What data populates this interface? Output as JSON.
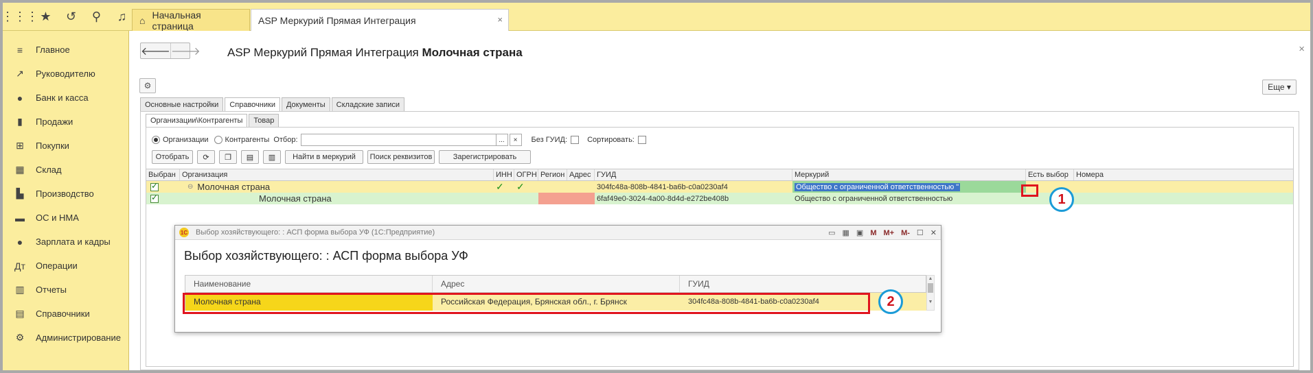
{
  "topbar": {
    "icons": [
      "grid-icon",
      "star-icon",
      "history-icon",
      "search-icon",
      "bell-icon"
    ],
    "tabs": [
      {
        "label": "Начальная страница",
        "icon": "home-icon"
      },
      {
        "label": "ASP Меркурий Прямая Интеграция",
        "close": "×"
      }
    ]
  },
  "sidebar": {
    "items": [
      {
        "label": "Главное",
        "icon": "menu-icon",
        "glyph": "≡"
      },
      {
        "label": "Руководителю",
        "icon": "trend-icon",
        "glyph": "↗"
      },
      {
        "label": "Банк и касса",
        "icon": "coin-icon",
        "glyph": "●"
      },
      {
        "label": "Продажи",
        "icon": "bag-icon",
        "glyph": "▮"
      },
      {
        "label": "Покупки",
        "icon": "cart-icon",
        "glyph": "⊞"
      },
      {
        "label": "Склад",
        "icon": "warehouse-icon",
        "glyph": "▦"
      },
      {
        "label": "Производство",
        "icon": "factory-icon",
        "glyph": "▙"
      },
      {
        "label": "ОС и НМА",
        "icon": "truck-icon",
        "glyph": "▬"
      },
      {
        "label": "Зарплата и кадры",
        "icon": "person-icon",
        "glyph": "●"
      },
      {
        "label": "Операции",
        "icon": "dt-kt-icon",
        "glyph": "Дт"
      },
      {
        "label": "Отчеты",
        "icon": "bar-chart-icon",
        "glyph": "▥"
      },
      {
        "label": "Справочники",
        "icon": "book-icon",
        "glyph": "▤"
      },
      {
        "label": "Администрирование",
        "icon": "gear-icon",
        "glyph": "⚙"
      }
    ]
  },
  "main": {
    "title": "ASP Меркурий Прямая Интеграция",
    "title_bold": "Молочная страна",
    "close": "×",
    "more_button": "Еще ▾",
    "tabs": [
      "Основные настройки",
      "Справочники",
      "Документы",
      "Складские записи"
    ],
    "subtabs": [
      "Организации\\Контрагенты",
      "Товар"
    ],
    "filters": {
      "radio_org": "Организации",
      "radio_contr": "Контрагенты",
      "otbor_label": "Отбор:",
      "dots": "...",
      "clear": "×",
      "no_guid": "Без ГУИД:",
      "sort": "Сортировать:"
    },
    "toolbar": {
      "select": "Отобрать",
      "find": "Найти в меркурий",
      "search_req": "Поиск реквизитов",
      "register": "Зарегистрировать"
    },
    "grid": {
      "columns": [
        "Выбран",
        "Организация",
        "ИНН",
        "ОГРН",
        "Регион",
        "Адрес",
        "ГУИД",
        "Меркурий",
        "Есть выбор",
        "Номера"
      ],
      "rows": [
        {
          "org": "Молочная страна",
          "guid": "304fc48a-808b-4841-ba6b-c0a0230af4",
          "mercury": "Общество с ограниченной ответственностью \""
        },
        {
          "org": "Молочная страна",
          "guid": "6faf49e0-3024-4a00-8d4d-e272be408b",
          "mercury": "Общество с ограниченной ответственностью"
        }
      ]
    }
  },
  "dialog": {
    "window_title": "Выбор хозяйствующего: : АСП форма выбора УФ  (1С:Предприятие)",
    "heading": "Выбор хозяйствующего: : АСП форма выбора УФ",
    "toolbar_icons": [
      "M",
      "M+",
      "M-"
    ],
    "columns": [
      "Наименование",
      "Адрес",
      "ГУИД"
    ],
    "row": {
      "name": "Молочная страна",
      "address": "Российская Федерация, Брянская обл., г. Брянск",
      "guid": "304fc48a-808b-4841-ba6b-c0a0230af4"
    }
  },
  "annotations": [
    "1",
    "2"
  ],
  "colors": {
    "panel_yellow": "#fbed9e",
    "row_yellow": "#fbeea6",
    "row_green": "#d8f3cf",
    "highlight_red": "#e0141e",
    "badge_blue": "#1b9bd7"
  }
}
